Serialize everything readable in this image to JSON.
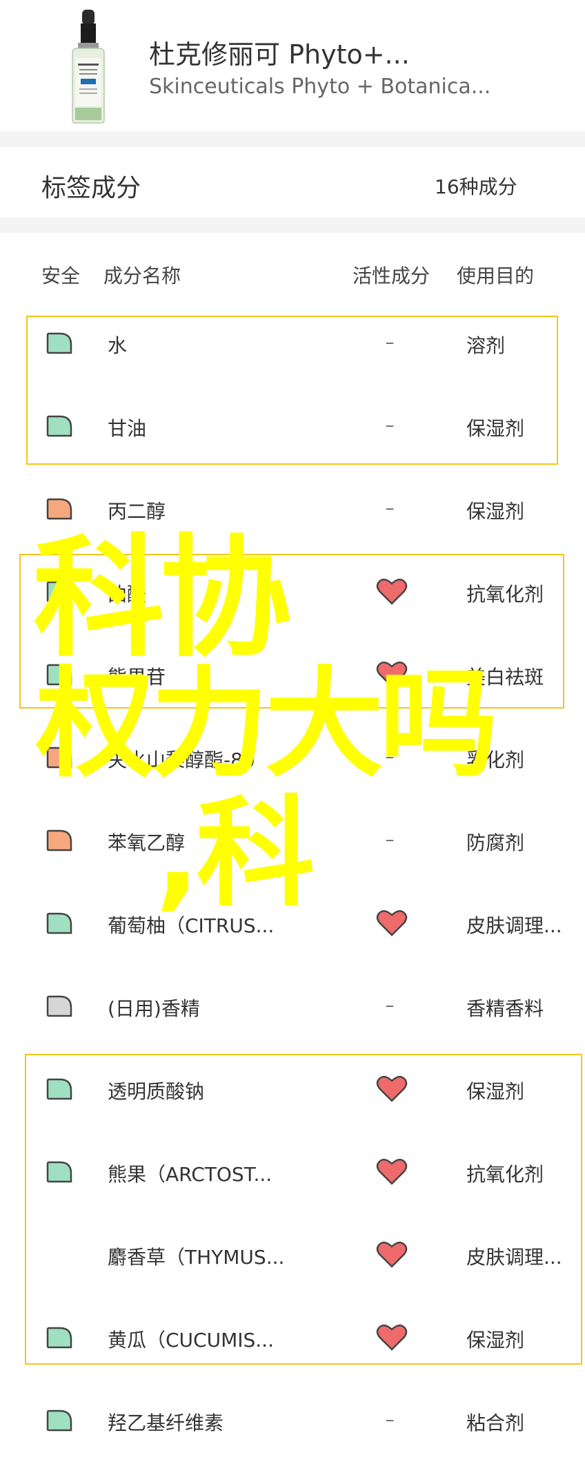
{
  "product": {
    "title": "杜克修丽可 Phyto+...",
    "subtitle": "Skinceuticals Phyto + Botanica...",
    "image_icon": "serum-bottle"
  },
  "section": {
    "title": "标签成分",
    "count": "16种成分"
  },
  "columns": {
    "safety": "安全",
    "name": "成分名称",
    "active": "活性成分",
    "usage": "使用目的"
  },
  "rows": [
    {
      "name": "水",
      "active": "–",
      "usage": "溶剂",
      "safety": "green"
    },
    {
      "name": "甘油",
      "active": "–",
      "usage": "保湿剂",
      "safety": "green"
    },
    {
      "name": "丙二醇",
      "active": "–",
      "usage": "保湿剂",
      "safety": "orange"
    },
    {
      "name": "曲酸",
      "active": "heart",
      "usage": "抗氧化剂",
      "safety": "green"
    },
    {
      "name": "熊果苷",
      "active": "heart",
      "usage": "美白祛斑",
      "safety": "green"
    },
    {
      "name": "失水山梨醇酯-80",
      "active": "–",
      "usage": "乳化剂",
      "safety": "orange"
    },
    {
      "name": "苯氧乙醇",
      "active": "–",
      "usage": "防腐剂",
      "safety": "orange"
    },
    {
      "name": "葡萄柚（CITRUS...",
      "active": "heart",
      "usage": "皮肤调理...",
      "safety": "green"
    },
    {
      "name": "(日用)香精",
      "active": "–",
      "usage": "香精香料",
      "safety": "gray"
    },
    {
      "name": "透明质酸钠",
      "active": "heart",
      "usage": "保湿剂",
      "safety": "green"
    },
    {
      "name": "熊果（ARCTOST...",
      "active": "heart",
      "usage": "抗氧化剂",
      "safety": "green"
    },
    {
      "name": "麝香草（THYMUS...",
      "active": "heart",
      "usage": "皮肤调理...",
      "safety": "none"
    },
    {
      "name": "黄瓜（CUCUMIS...",
      "active": "heart",
      "usage": "保湿剂",
      "safety": "green"
    },
    {
      "name": "羟乙基纤维素",
      "active": "–",
      "usage": "粘合剂",
      "safety": "green"
    }
  ],
  "overlay": {
    "line1": "科协",
    "line2": "权力大吗",
    "line3": ",科"
  },
  "colors": {
    "safe_green": "#9fe0c0",
    "caution_orange": "#f7a77d",
    "unknown_gray": "#d6d6d6",
    "heart": "#ef6b6b",
    "group_border": "#f5c518",
    "overlay_text": "#ffff00"
  }
}
